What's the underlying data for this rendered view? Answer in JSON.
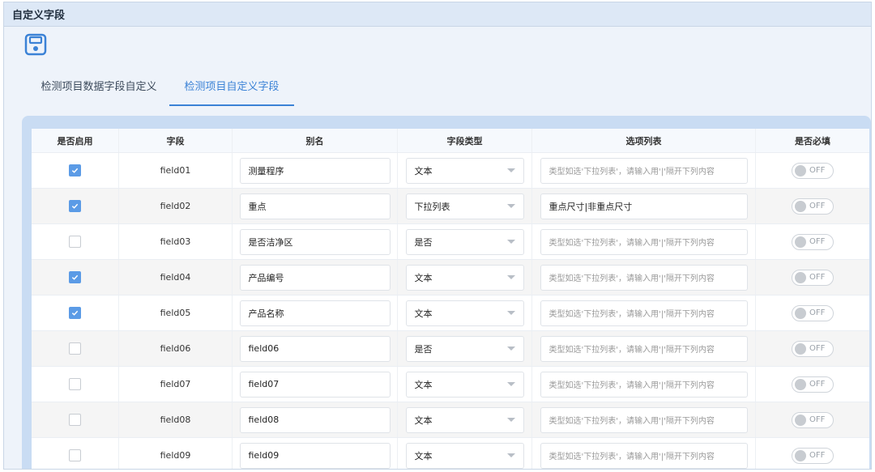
{
  "window": {
    "title": "自定义字段"
  },
  "tabs": [
    {
      "label": "检测项目数据字段自定义"
    },
    {
      "label": "检测项目自定义字段"
    }
  ],
  "table": {
    "headers": [
      "是否启用",
      "字段",
      "别名",
      "字段类型",
      "选项列表",
      "是否必填"
    ],
    "option_placeholder": "类型如选'下拉列表'，请输入用'|'隔开下列内容",
    "rows": [
      {
        "enabled": true,
        "field": "field01",
        "alias": "测量程序",
        "type": "文本",
        "options": "",
        "required": "OFF"
      },
      {
        "enabled": true,
        "field": "field02",
        "alias": "重点",
        "type": "下拉列表",
        "options": "重点尺寸|非重点尺寸",
        "required": "OFF"
      },
      {
        "enabled": false,
        "field": "field03",
        "alias": "是否洁净区",
        "type": "是否",
        "options": "",
        "required": "OFF"
      },
      {
        "enabled": true,
        "field": "field04",
        "alias": "产品编号",
        "type": "文本",
        "options": "",
        "required": "OFF"
      },
      {
        "enabled": true,
        "field": "field05",
        "alias": "产品名称",
        "type": "文本",
        "options": "",
        "required": "OFF"
      },
      {
        "enabled": false,
        "field": "field06",
        "alias": "field06",
        "type": "是否",
        "options": "",
        "required": "OFF"
      },
      {
        "enabled": false,
        "field": "field07",
        "alias": "field07",
        "type": "文本",
        "options": "",
        "required": "OFF"
      },
      {
        "enabled": false,
        "field": "field08",
        "alias": "field08",
        "type": "文本",
        "options": "",
        "required": "OFF"
      },
      {
        "enabled": false,
        "field": "field09",
        "alias": "field09",
        "type": "文本",
        "options": "",
        "required": "OFF"
      }
    ]
  },
  "colors": {
    "accent": "#3b82d6",
    "checkbox": "#5b9be6",
    "header_bg": "#dde8f6",
    "panel_bg": "#c9dcf3"
  }
}
